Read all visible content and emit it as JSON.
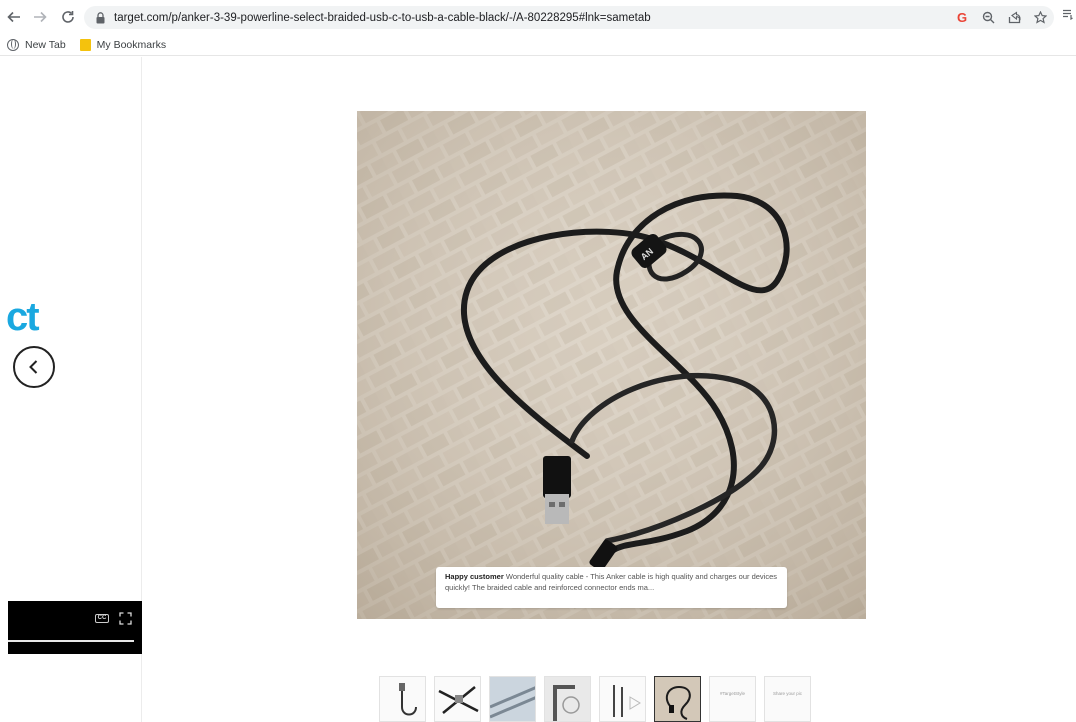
{
  "browser": {
    "url": "target.com/p/anker-3-39-powerline-select-braided-usb-c-to-usb-a-cable-black/-/A-80228295#lnk=sametab",
    "icons": [
      "back-icon",
      "forward-icon",
      "reload-icon",
      "lock-icon",
      "google-icon",
      "zoom-icon",
      "share-icon",
      "star-icon",
      "reading-list-icon"
    ]
  },
  "bookmarks": [
    {
      "label": "New Tab",
      "icon": "globe-icon"
    },
    {
      "label": "My Bookmarks",
      "icon": "folder-icon"
    }
  ],
  "left_panel": {
    "logo_fragment": "ct",
    "prev_icon": "chevron-left-icon",
    "video": {
      "cc_label": "CC",
      "fullscreen_icon": "fullscreen-icon"
    }
  },
  "main_image": {
    "caption": {
      "author": "Happy customer",
      "text": "Wonderful quality cable - This Anker cable is high quality and charges our devices quickly! The braided cable and reinforced connector ends ma..."
    }
  },
  "thumbnails": [
    {
      "label": ""
    },
    {
      "label": ""
    },
    {
      "label": ""
    },
    {
      "label": ""
    },
    {
      "label": ""
    },
    {
      "label": "",
      "selected": true
    },
    {
      "label": "#TargetStyle"
    },
    {
      "label": "Share your pic"
    }
  ],
  "colors": {
    "logo_blue": "#1aa8e0",
    "omnibox_bg": "#f1f3f4",
    "folder_yellow": "#f4c20d"
  }
}
